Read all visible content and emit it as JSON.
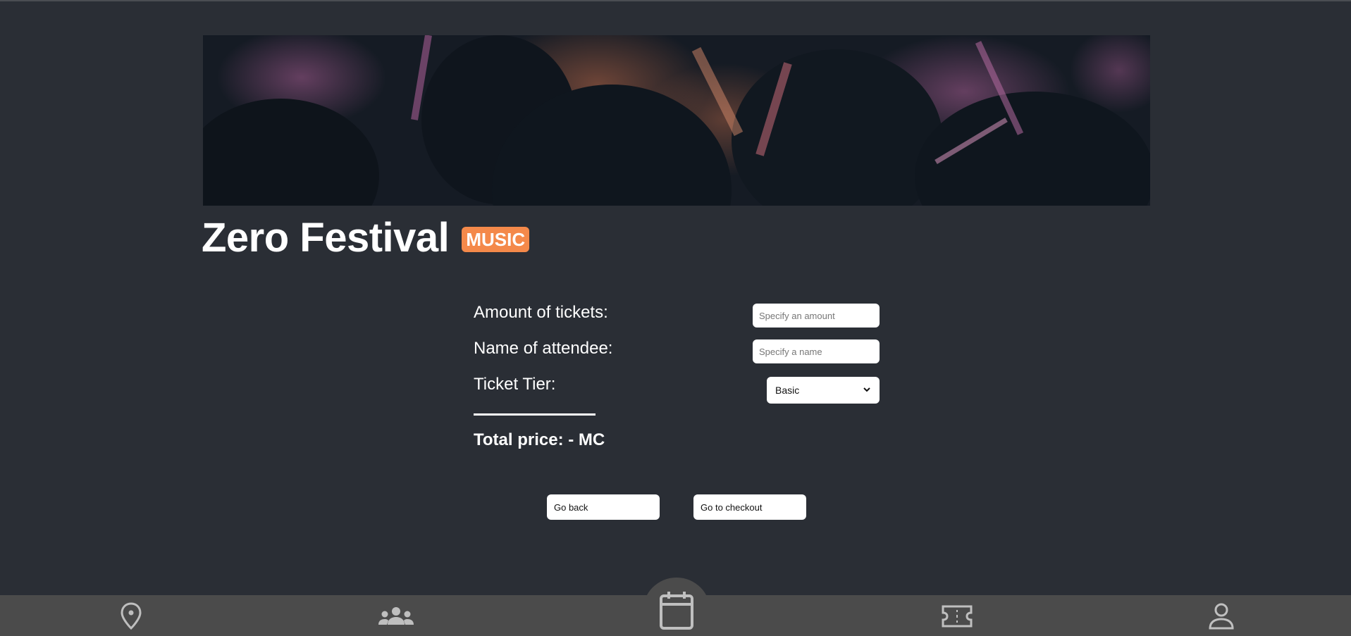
{
  "event": {
    "title": "Zero Festival",
    "category": "MUSIC",
    "category_color": "#f4894a"
  },
  "form": {
    "amount_label": "Amount of tickets:",
    "amount_placeholder": "Specify an amount",
    "amount_value": "",
    "name_label": "Name of attendee:",
    "name_placeholder": "Specify a name",
    "name_value": "",
    "tier_label": "Ticket Tier:",
    "tier_selected": "Basic"
  },
  "total": {
    "text": "Total price: - MC"
  },
  "buttons": {
    "back_label": "Go back",
    "checkout_label": "Go to checkout"
  },
  "navbar": {
    "items": [
      {
        "icon": "location-pin-icon"
      },
      {
        "icon": "group-icon"
      },
      {
        "icon": "calendar-icon",
        "active": true
      },
      {
        "icon": "ticket-icon"
      },
      {
        "icon": "profile-icon"
      }
    ]
  },
  "colors": {
    "background": "#2a2e35",
    "navbar": "#4b4b4b",
    "accent": "#f4894a"
  }
}
